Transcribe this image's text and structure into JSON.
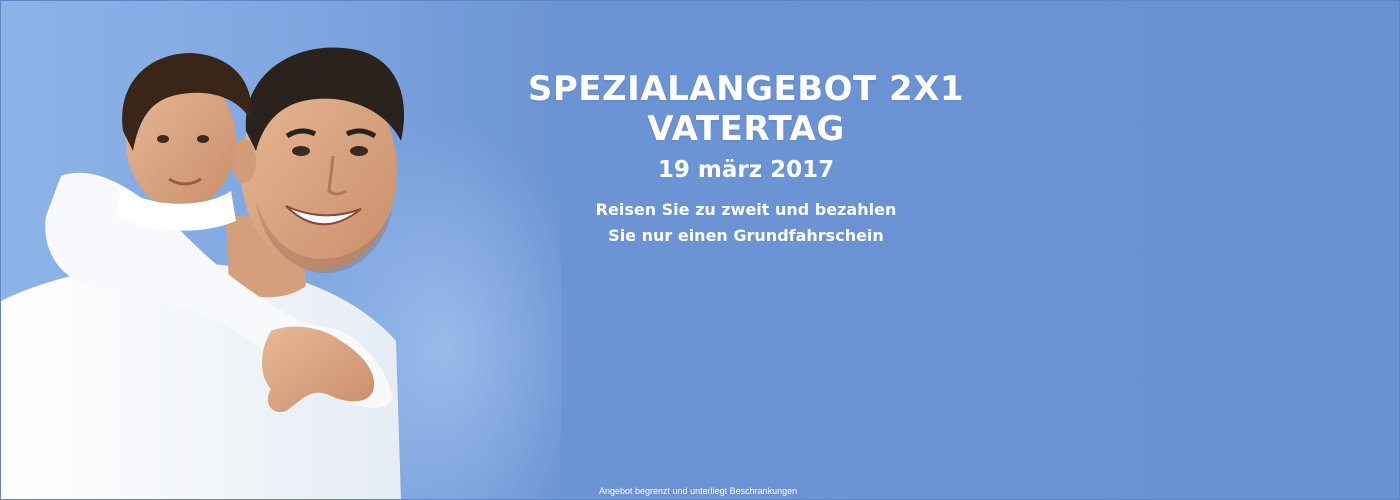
{
  "banner": {
    "title_line_1": "SPEZIALANGEBOT 2X1",
    "title_line_2": "VATERTAG",
    "date": "19 märz 2017",
    "subtitle_line_1": "Reisen Sie zu zweit und bezahlen",
    "subtitle_line_2": "Sie nur einen Grundfahrschein",
    "disclaimer": "Angebot begrenzt und unterliegt Beschrankungen"
  },
  "colors": {
    "background": "#6a92d2",
    "background_light": "#8db4e8",
    "text": "#ffffff"
  }
}
